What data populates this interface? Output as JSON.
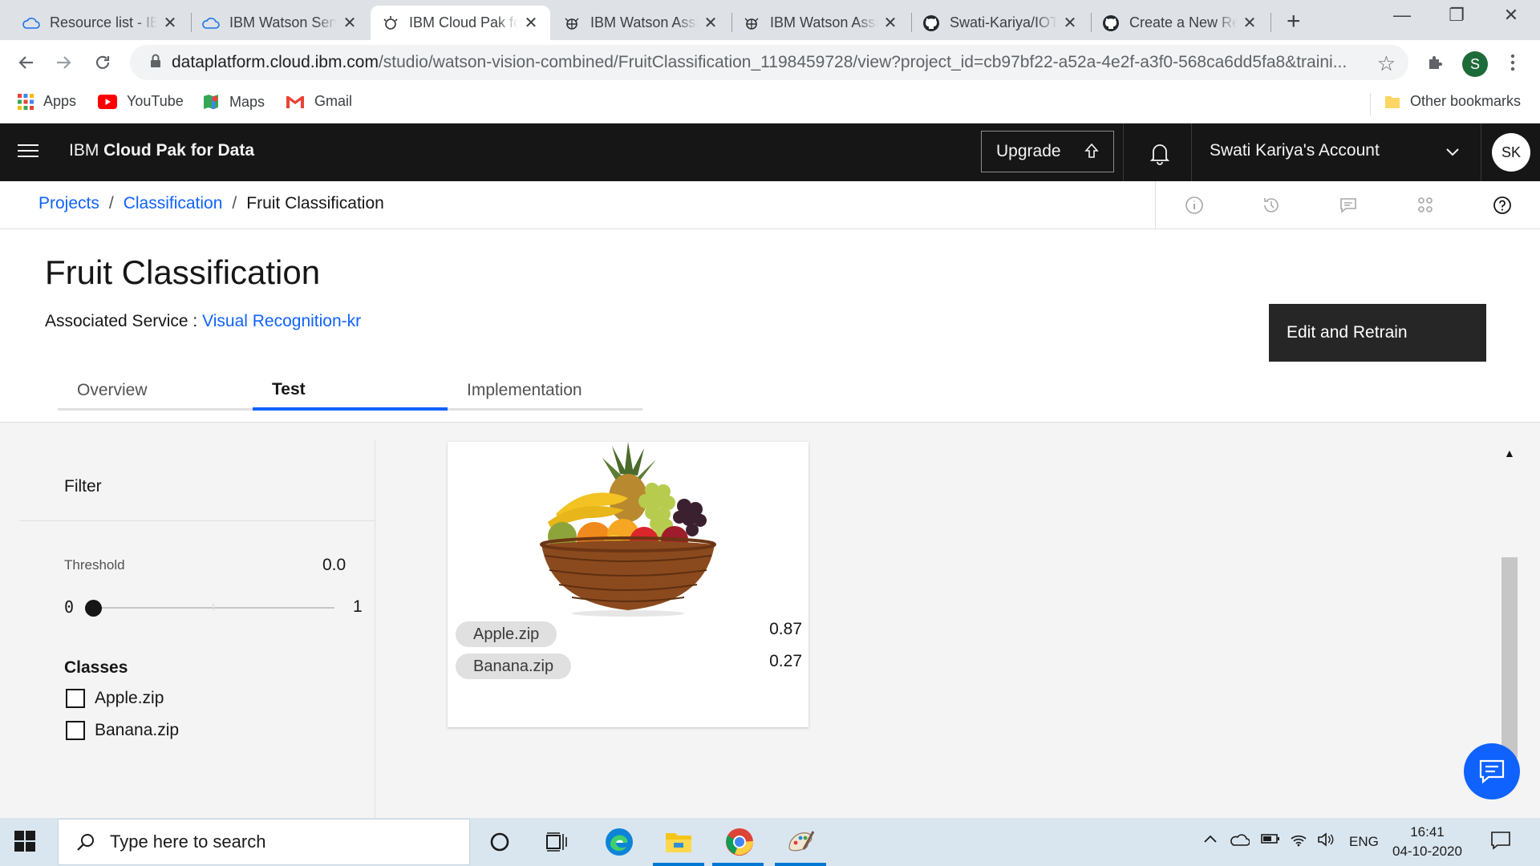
{
  "browser": {
    "tabs": [
      {
        "title": "Resource list - IBM",
        "icon": "cloud-icon",
        "active": false
      },
      {
        "title": "IBM Watson Services",
        "icon": "cloud-icon",
        "active": false
      },
      {
        "title": "IBM Cloud Pak for Data",
        "icon": "ibm-cloudpak-icon",
        "active": true
      },
      {
        "title": "IBM Watson Assistant",
        "icon": "watson-icon",
        "active": false
      },
      {
        "title": "IBM Watson Assistant",
        "icon": "watson-icon",
        "active": false
      },
      {
        "title": "Swati-Kariya/IOT",
        "icon": "github-icon",
        "active": false
      },
      {
        "title": "Create a New Repository",
        "icon": "github-icon",
        "active": false
      }
    ],
    "url_host": "dataplatform.cloud.ibm.com",
    "url_path": "/studio/watson-vision-combined/FruitClassification_1198459728/view?project_id=cb97bf22-a52a-4e2f-a3f0-568ca6dd5fa8&traini...",
    "profile_initial": "S",
    "bookmarks": [
      {
        "label": "Apps",
        "icon": "apps-grid-icon"
      },
      {
        "label": "YouTube",
        "icon": "youtube-icon"
      },
      {
        "label": "Maps",
        "icon": "maps-icon"
      },
      {
        "label": "Gmail",
        "icon": "gmail-icon"
      }
    ],
    "other_bookmarks": "Other bookmarks"
  },
  "header": {
    "brand_prefix": "IBM ",
    "brand_name": "Cloud Pak for Data",
    "upgrade_label": "Upgrade",
    "account_name": "Swati Kariya's Account",
    "avatar_initials": "SK"
  },
  "breadcrumb": {
    "items": [
      "Projects",
      "Classification"
    ],
    "current": "Fruit Classification",
    "separator": "/"
  },
  "page": {
    "title": "Fruit Classification",
    "associated_label": "Associated Service : ",
    "associated_link": "Visual Recognition-kr",
    "retrain_button": "Edit and Retrain",
    "tabs": [
      "Overview",
      "Test",
      "Implementation"
    ],
    "active_tab": "Test"
  },
  "filter": {
    "heading": "Filter",
    "threshold_label": "Threshold",
    "threshold_value": "0.0",
    "slider_min": "0",
    "slider_max": "1",
    "slider_position": 0,
    "classes_heading": "Classes",
    "classes": [
      "Apple.zip",
      "Banana.zip"
    ]
  },
  "result_card": {
    "image_alt": "fruit-basket",
    "predictions": [
      {
        "class": "Apple.zip",
        "score": "0.87"
      },
      {
        "class": "Banana.zip",
        "score": "0.27"
      }
    ]
  },
  "taskbar": {
    "search_placeholder": "Type here to search",
    "language": "ENG",
    "time": "16:41",
    "date": "04-10-2020"
  },
  "colors": {
    "ibm_blue": "#0f62fe",
    "header_bg": "#161616",
    "page_bg": "#f4f4f4"
  }
}
